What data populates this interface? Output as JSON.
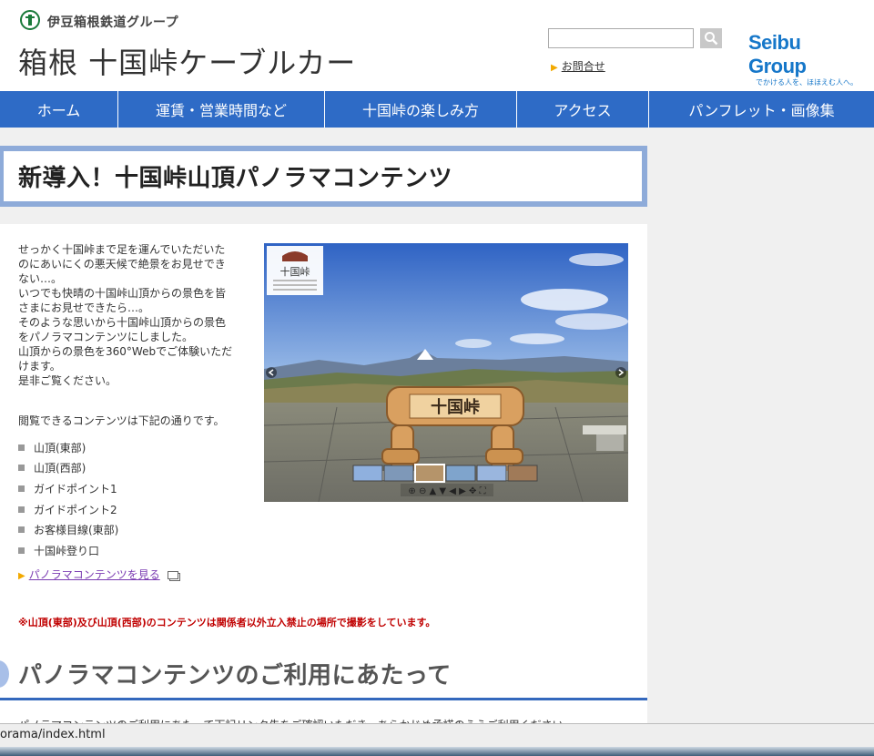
{
  "header": {
    "brand_text": "伊豆箱根鉄道グループ",
    "site_title": "箱根 十国峠ケーブルカー",
    "search_placeholder": "",
    "contact_label": "お問合せ",
    "partner_name": "Seibu Group",
    "partner_tagline": "でかける人を、ほほえむ人へ。"
  },
  "nav": {
    "items": [
      {
        "label": "ホーム"
      },
      {
        "label": "運賃・営業時間など"
      },
      {
        "label": "十国峠の楽しみ方"
      },
      {
        "label": "アクセス"
      },
      {
        "label": "パンフレット・画像集"
      }
    ]
  },
  "page": {
    "title": "新導入！十国峠山頂パノラマコンテンツ"
  },
  "content": {
    "intro_lines": [
      "せっかく十国峠まで足を運んでいただいた",
      "のにあいにくの悪天候で絶景をお見せでき",
      "ない…。",
      "いつでも快晴の十国峠山頂からの景色を皆",
      "さまにお見せできたら…。",
      "そのような思いから十国峠山頂からの景色",
      "をパノラマコンテンツにしました。",
      "山頂からの景色を360°Webでご体験いただ",
      "けます。",
      "是非ご覧ください。"
    ],
    "list_lead": "閲覧できるコンテンツは下記の通りです。",
    "list_items": [
      "山頂(東部)",
      "山頂(西部)",
      "ガイドポイント1",
      "ガイドポイント2",
      "お客様目線(東部)",
      "十国峠登り口"
    ],
    "panorama_link": "パノラマコンテンツを見る",
    "notice": "※山頂(東部)及び山頂(西部)のコンテンツは関係者以外立入禁止の場所で撮影をしています。",
    "panorama": {
      "sign_text": "十国峠",
      "logo_title": "十国峠",
      "thumbnails_count_selected": 3
    }
  },
  "section": {
    "heading": "パノラマコンテンツのご利用にあたって",
    "text": "パノラマコンテンツのご利用にあたって下記リンク先をご確認いただき、あらかじめ承諾のうえご利用ください。"
  },
  "statusbar": {
    "url": "orama/index.html"
  },
  "colors": {
    "nav": "#2e6bc6",
    "title_border": "#8eabd9",
    "notice": "#c00000",
    "accent_triangle": "#f2a900",
    "seibu_blue": "#1677c9"
  }
}
